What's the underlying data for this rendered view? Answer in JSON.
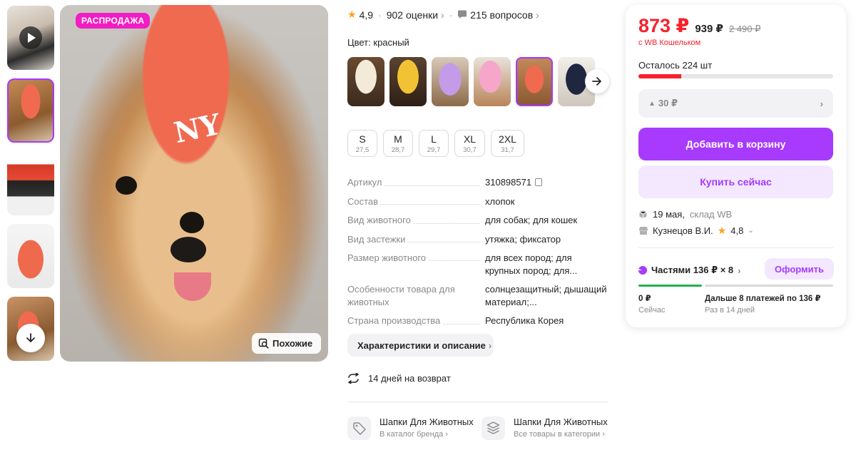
{
  "gallery": {
    "sale_badge": "РАСПРОДАЖА",
    "similar_label": "Похожие"
  },
  "rating": {
    "score": "4,9",
    "reviews": "902 оценки",
    "questions": "215 вопросов"
  },
  "color": {
    "label": "Цвет:",
    "value": "красный"
  },
  "sizes": [
    {
      "size": "S",
      "num": "27,5"
    },
    {
      "size": "M",
      "num": "28,7"
    },
    {
      "size": "L",
      "num": "29,7"
    },
    {
      "size": "XL",
      "num": "30,7"
    },
    {
      "size": "2XL",
      "num": "31,7"
    }
  ],
  "specs": [
    {
      "key": "Артикул",
      "value": "310898571"
    },
    {
      "key": "Состав",
      "value": "хлопок"
    },
    {
      "key": "Вид животного",
      "value": "для собак; для кошек"
    },
    {
      "key": "Вид застежки",
      "value": "утяжка; фиксатор"
    },
    {
      "key": "Размер животного",
      "value": "для всех пород; для крупных пород; для..."
    },
    {
      "key": "Особенности товара для животных",
      "value": "солнцезащитный; дышащий материал;..."
    },
    {
      "key": "Страна производства",
      "value": "Республика Корея"
    }
  ],
  "chars_button": "Характеристики и описание",
  "return_policy": "14 дней на возврат",
  "brand_links": [
    {
      "title": "Шапки Для Животных",
      "sub": "В каталог бренда"
    },
    {
      "title": "Шапки Для Животных",
      "sub": "Все товары в категории"
    }
  ],
  "buy_card": {
    "price": "873 ₽",
    "price_regular": "939 ₽",
    "price_old": "2 490 ₽",
    "wallet_note": "с WB Кошельком",
    "stock_left": "Осталось 224 шт",
    "stock_fraction": 0.22,
    "bonus": "30 ₽",
    "add_to_cart": "Добавить в корзину",
    "buy_now": "Купить сейчас",
    "delivery_date": "19 мая,",
    "delivery_warehouse": "склад WB",
    "seller_name": "Кузнецов В.И.",
    "seller_rating": "4,8",
    "installments": "Частями 136 ₽ × 8",
    "checkout_button": "Оформить",
    "now_amount": "0 ₽",
    "now_label": "Сейчас",
    "later_amount": "Дальше 8 платежей по 136 ₽",
    "later_label": "Раз в 14 дней"
  },
  "colors": {
    "accent": "#a73afd",
    "price_red": "#f5222d",
    "sale_pink": "#f01ec3",
    "star": "#ff9f1a",
    "progress_green": "#22b14c"
  }
}
